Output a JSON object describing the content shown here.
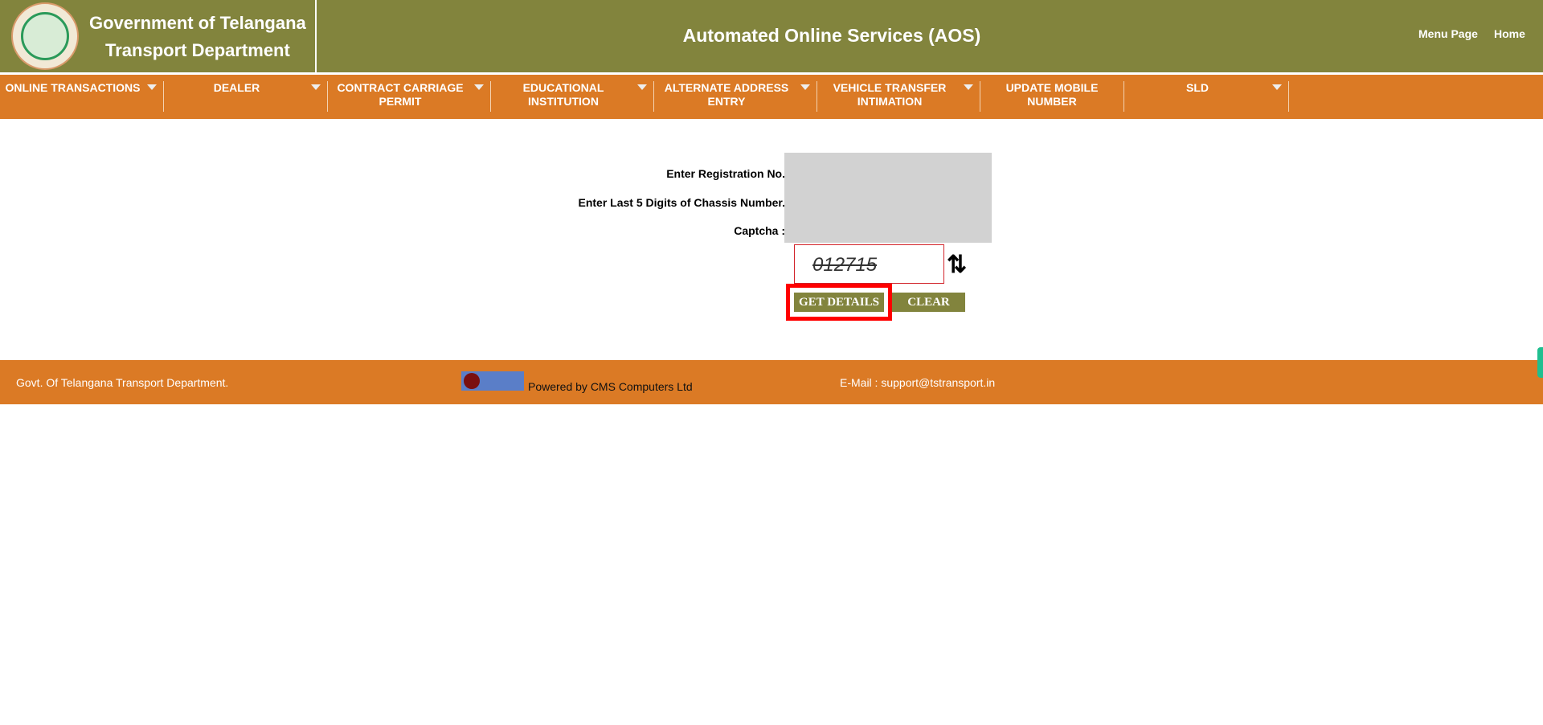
{
  "header": {
    "dept_line1": "Government of Telangana",
    "dept_line2": "Transport Department",
    "title": "Automated Online Services (AOS)",
    "links": [
      "Menu Page",
      "Home"
    ]
  },
  "nav": [
    {
      "label": "ONLINE TRANSACTIONS",
      "dropdown": true
    },
    {
      "label": "DEALER",
      "dropdown": true
    },
    {
      "label": "CONTRACT CARRIAGE PERMIT",
      "dropdown": true
    },
    {
      "label": "EDUCATIONAL INSTITUTION",
      "dropdown": true
    },
    {
      "label": "ALTERNATE ADDRESS ENTRY",
      "dropdown": true
    },
    {
      "label": "VEHICLE TRANSFER INTIMATION",
      "dropdown": true
    },
    {
      "label": "UPDATE MOBILE NUMBER",
      "dropdown": false
    },
    {
      "label": "SLD",
      "dropdown": true
    }
  ],
  "form": {
    "reg_label": "Enter Registration No.",
    "chassis_label": "Enter Last 5 Digits of Chassis Number.",
    "captcha_label": "Captcha :",
    "captcha_value": "012715",
    "get_details": "GET DETAILS",
    "clear": "CLEAR"
  },
  "footer": {
    "left": "Govt. Of Telangana Transport Department.",
    "logo": "CMS",
    "powered": "Powered by CMS Computers Ltd",
    "email": "E-Mail : support@tstransport.in"
  },
  "colors": {
    "header": "#82843d",
    "nav": "#db7a25",
    "highlight": "#ff0000"
  }
}
